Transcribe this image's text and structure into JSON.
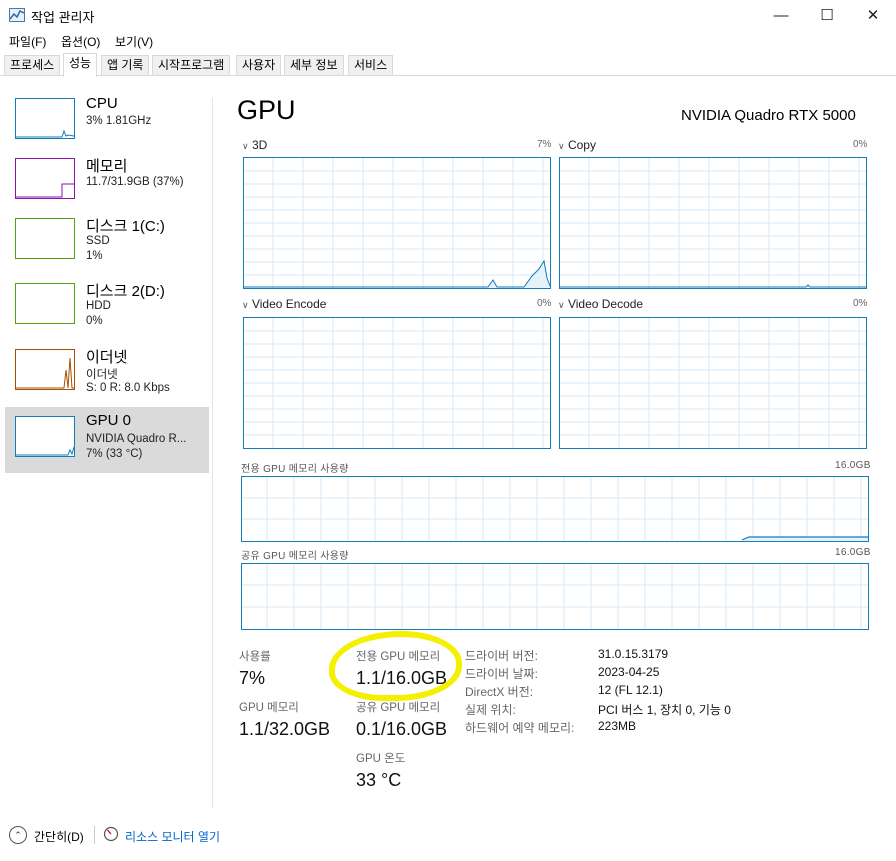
{
  "window": {
    "title": "작업 관리자",
    "minimize": "—",
    "maximize": "☐",
    "close": "✕"
  },
  "menu": [
    "파일(F)",
    "옵션(O)",
    "보기(V)"
  ],
  "tabs": [
    "프로세스",
    "성능",
    "앱 기록",
    "시작프로그램",
    "사용자",
    "세부 정보",
    "서비스"
  ],
  "active_tab": "성능",
  "sidebar": {
    "items": [
      {
        "title": "CPU",
        "line1": "3% 1.81GHz",
        "line2": "",
        "color": "#117dbb"
      },
      {
        "title": "메모리",
        "line1": "11.7/31.9GB (37%)",
        "line2": "",
        "color": "#8b12ae"
      },
      {
        "title": "디스크 1(C:)",
        "line1": "SSD",
        "line2": "1%",
        "color": "#4da60c"
      },
      {
        "title": "디스크 2(D:)",
        "line1": "HDD",
        "line2": "0%",
        "color": "#4da60c"
      },
      {
        "title": "이더넷",
        "line1": "이더넷",
        "line2": "S: 0  R: 8.0 Kbps",
        "color": "#a74f01"
      },
      {
        "title": "GPU 0",
        "line1": "NVIDIA Quadro R...",
        "line2": "7% (33 °C)",
        "color": "#117dbb"
      }
    ]
  },
  "main": {
    "title": "GPU",
    "model": "NVIDIA Quadro RTX 5000",
    "graphs": [
      {
        "label": "3D",
        "pct": "7%"
      },
      {
        "label": "Copy",
        "pct": "0%"
      },
      {
        "label": "Video Encode",
        "pct": "0%"
      },
      {
        "label": "Video Decode",
        "pct": "0%"
      }
    ],
    "dedicated_mem_label": "전용 GPU 메모리 사용량",
    "dedicated_mem_max": "16.0GB",
    "shared_mem_label": "공유 GPU 메모리 사용량",
    "shared_mem_max": "16.0GB",
    "stats": {
      "usage_label": "사용률",
      "usage_value": "7%",
      "dedicated_label": "전용 GPU 메모리",
      "dedicated_value": "1.1/16.0GB",
      "gpu_mem_label": "GPU 메모리",
      "gpu_mem_value": "1.1/32.0GB",
      "shared_label": "공유 GPU 메모리",
      "shared_value": "0.1/16.0GB",
      "temp_label": "GPU 온도",
      "temp_value": "33 °C"
    },
    "info": [
      {
        "label": "드라이버 버전:",
        "value": "31.0.15.3179"
      },
      {
        "label": "드라이버 날짜:",
        "value": "2023-04-25"
      },
      {
        "label": "DirectX 버전:",
        "value": "12 (FL 12.1)"
      },
      {
        "label": "실제 위치:",
        "value": "PCI 버스 1, 장치 0, 기능 0"
      },
      {
        "label": "하드웨어 예약 메모리:",
        "value": "223MB"
      }
    ]
  },
  "bottom": {
    "fewer_details": "간단히(D)",
    "resource_monitor": "리소스 모니터 열기"
  },
  "colors": {
    "gpu": "#117dbb",
    "highlight": "#f5f000",
    "link": "#0066cc"
  }
}
